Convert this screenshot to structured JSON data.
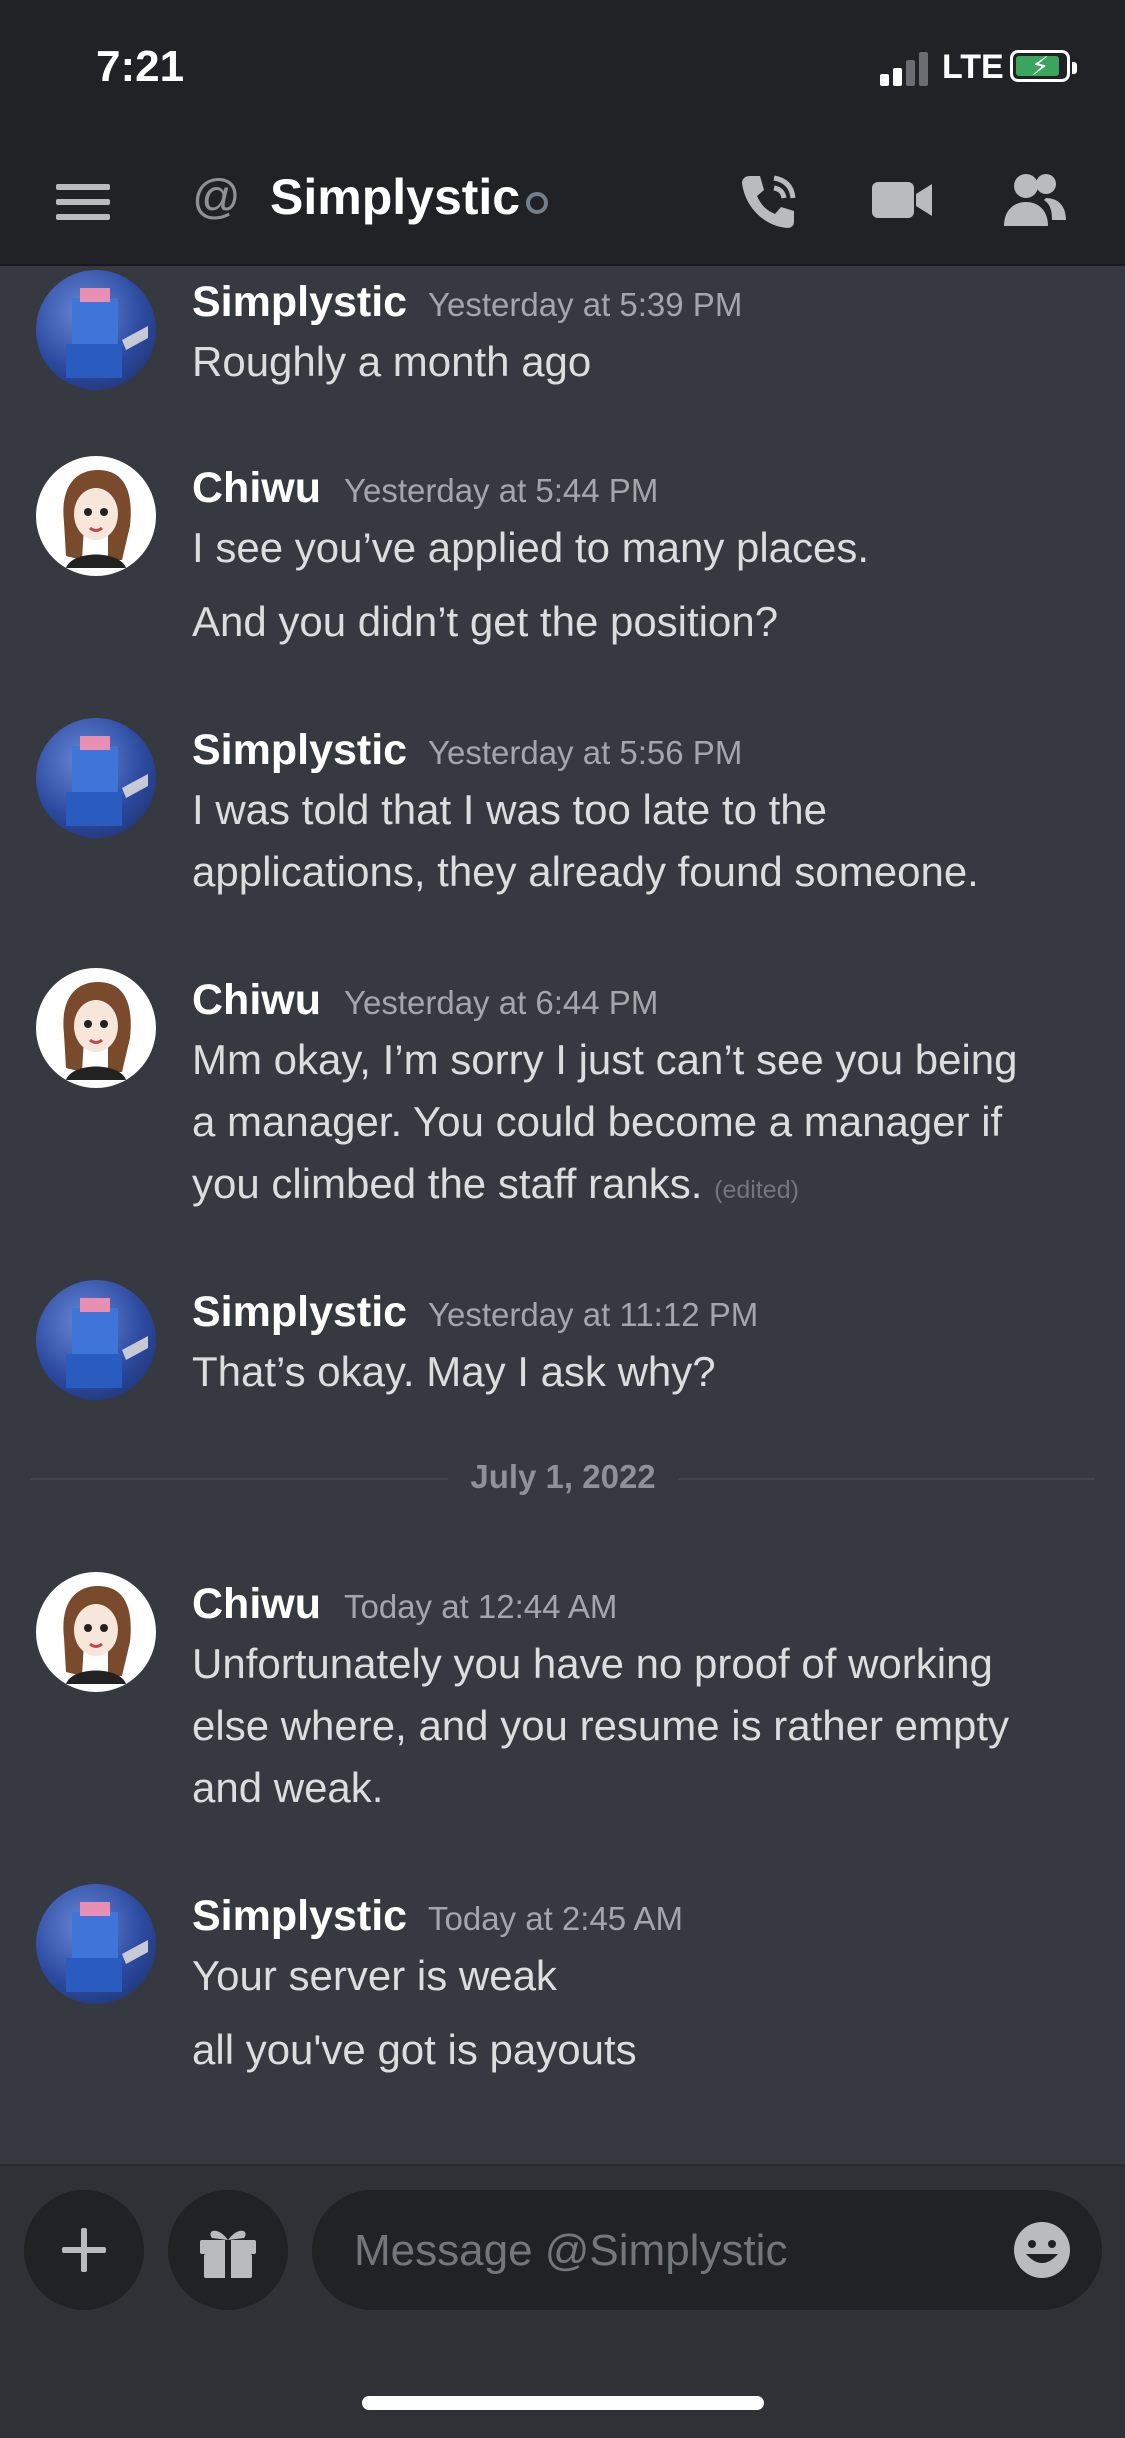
{
  "status_bar": {
    "time": "7:21",
    "network": "LTE"
  },
  "header": {
    "at_symbol": "@",
    "title": "Simplystic",
    "icons": [
      "menu-icon",
      "call-icon",
      "video-icon",
      "members-icon"
    ]
  },
  "messages": [
    {
      "author": "Simplystic",
      "timestamp": "Yesterday at 5:39 PM",
      "lines": [
        "Roughly a month ago"
      ]
    },
    {
      "author": "Chiwu",
      "timestamp": "Yesterday at 5:44 PM",
      "lines": [
        "I see you’ve applied to many places.",
        "And you didn’t get the position?"
      ]
    },
    {
      "author": "Simplystic",
      "timestamp": "Yesterday at 5:56 PM",
      "lines": [
        "I was told that I was too late to the",
        "applications, they already found someone."
      ]
    },
    {
      "author": "Chiwu",
      "timestamp": "Yesterday at 6:44 PM",
      "lines": [
        "Mm okay, I’m sorry I just can’t see you being",
        "a manager. You could become a manager if",
        "you climbed the staff ranks."
      ],
      "edited": "(edited)"
    },
    {
      "author": "Simplystic",
      "timestamp": "Yesterday at 11:12 PM",
      "lines": [
        "That’s okay. May I ask why?"
      ]
    },
    {
      "author": "Chiwu",
      "timestamp": "Today at 12:44 AM",
      "lines": [
        "Unfortunately you have no proof of working",
        "else where, and you resume is rather empty",
        "and weak."
      ]
    },
    {
      "author": "Simplystic",
      "timestamp": "Today at 2:45 AM",
      "lines": [
        "Your server is weak",
        "all you've got is payouts"
      ]
    }
  ],
  "date_divider": "July 1, 2022",
  "composer": {
    "placeholder": "Message @Simplystic"
  },
  "colors": {
    "background": "#36393f",
    "header": "#202225",
    "status_idle": "#747f8d",
    "battery": "#3ba55d"
  }
}
